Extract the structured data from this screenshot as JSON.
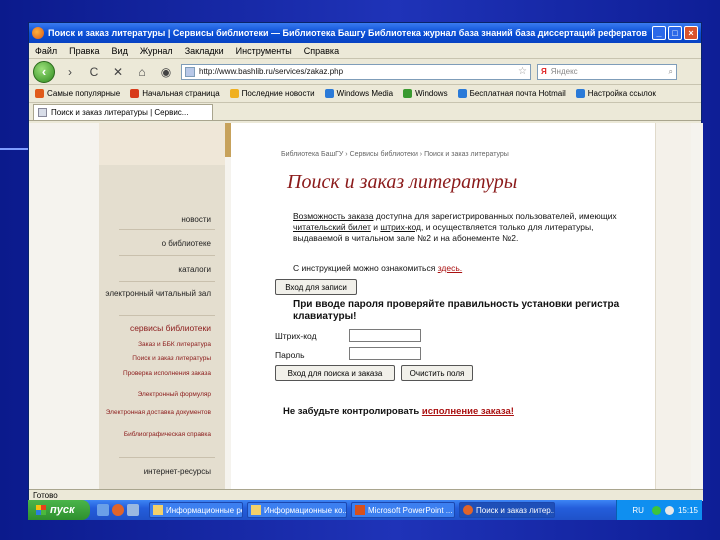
{
  "window": {
    "title": "Поиск и заказ литературы | Сервисы библиотеки — Библиотека Башгу Библиотека журнал база знаний база диссертаций рефератов ний жур...",
    "btn_min": "_",
    "btn_max": "□",
    "btn_close": "×"
  },
  "menu": [
    "Файл",
    "Правка",
    "Вид",
    "Журнал",
    "Закладки",
    "Инструменты",
    "Справка"
  ],
  "nav": {
    "back": "‹",
    "forward": "›",
    "reload": "C",
    "stop": "✕",
    "home": "⌂",
    "history": "◉",
    "url": "http://www.bashlib.ru/services/zakaz.php",
    "star": "☆",
    "search_logo": "Я",
    "search_placeholder": "Яндекс",
    "search_icon": "⌕"
  },
  "bookmarks": [
    {
      "label": "Самые популярные",
      "color": "#e05a1a"
    },
    {
      "label": "Начальная страница",
      "color": "#d83b1a"
    },
    {
      "label": "Последние новости",
      "color": "#f0b020"
    },
    {
      "label": "Windows Media",
      "color": "#2a7ad8"
    },
    {
      "label": "Windows",
      "color": "#3a9a30"
    },
    {
      "label": "Бесплатная почта Hotmail",
      "color": "#2a7ad8"
    },
    {
      "label": "Настройка ссылок",
      "color": "#2a7ad8"
    }
  ],
  "tab": {
    "label": "Поиск и заказ литературы | Сервис..."
  },
  "sidebar": {
    "items": [
      "новости",
      "о библиотеке",
      "каталоги",
      "электронный читальный зал",
      "сервисы библиотеки",
      "Заказ и ББК литература",
      "Поиск и заказ литературы",
      "Проверка исполнения заказа",
      "Электронный формуляр",
      "Электронная доставка документов",
      "Библиографическая справка",
      "интернет-ресурсы"
    ]
  },
  "page": {
    "breadcrumb": "Библиотека БашГУ › Сервисы библиотеки › Поиск и заказ литературы",
    "title": "Поиск и заказ литературы",
    "para1_a": "Возможность заказа",
    "para1_b": " доступна для зарегистрированных пользователей, имеющих ",
    "para1_c": "читательский билет",
    "para1_d": " и ",
    "para1_e": "штрих-код",
    "para1_f": ", и осуществляется только для литературы, выдаваемой в читальном зале №2 и на абонементе №2.",
    "para2_a": "С инструкцией можно ознакомиться ",
    "para2_link": "здесь.",
    "enter_button": "Вход для записи",
    "warning": "При вводе пароля проверяйте правильность установки регистра клавиатуры!",
    "barcode_label": "Штрих-код",
    "password_label": "Пароль",
    "login_button": "Вход для поиска и заказа",
    "clear_button": "Очистить поля",
    "remember_a": "Не забудьте контролировать ",
    "remember_link": "исполнение заказа!"
  },
  "status": {
    "text": "Готово"
  },
  "taskbar": {
    "start": "пуск",
    "tasks": [
      "Информационные ре...",
      "Информационные ко...",
      "Microsoft PowerPoint ...",
      "Поиск и заказ литер..."
    ],
    "lang": "RU",
    "time": "15:15"
  }
}
